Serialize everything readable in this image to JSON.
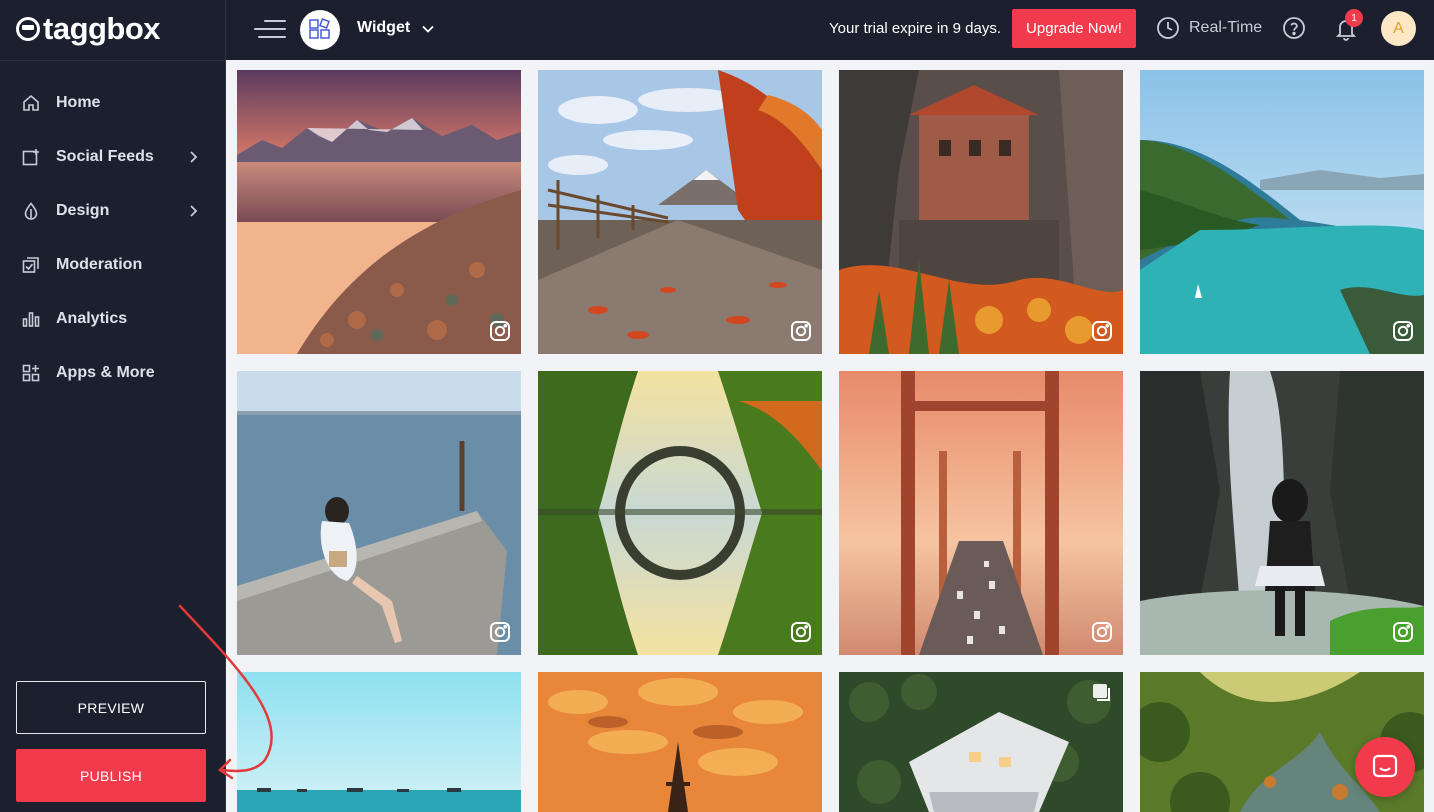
{
  "brand": {
    "logo_text": "taggbox",
    "accent": "#f13a4b",
    "sidebar_bg": "#1b1f2e"
  },
  "sidebar": {
    "items": [
      {
        "label": "Home",
        "icon": "home-icon",
        "has_submenu": false
      },
      {
        "label": "Social Feeds",
        "icon": "add-feed-icon",
        "has_submenu": true
      },
      {
        "label": "Design",
        "icon": "droplet-icon",
        "has_submenu": true
      },
      {
        "label": "Moderation",
        "icon": "moderation-icon",
        "has_submenu": false
      },
      {
        "label": "Analytics",
        "icon": "bar-chart-icon",
        "has_submenu": false
      },
      {
        "label": "Apps & More",
        "icon": "apps-grid-icon",
        "has_submenu": false
      }
    ],
    "preview_label": "PREVIEW",
    "publish_label": "PUBLISH"
  },
  "topbar": {
    "widget_label": "Widget",
    "trial_text": "Your trial expire in 9 days.",
    "upgrade_label": "Upgrade Now!",
    "realtime_label": "Real-Time",
    "notification_count": "1",
    "user_initial": "A"
  },
  "feed": {
    "tiles": [
      {
        "scene": "mountain-lake-sunset",
        "source": "instagram-icon"
      },
      {
        "scene": "autumn-path-mount-fuji",
        "source": "instagram-icon"
      },
      {
        "scene": "meteora-monastery-cliff",
        "source": "instagram-icon"
      },
      {
        "scene": "turquoise-lake-valley",
        "source": "instagram-icon"
      },
      {
        "scene": "woman-sitting-on-pier",
        "source": "instagram-icon"
      },
      {
        "scene": "stone-arch-bridge-reflection",
        "source": "instagram-icon"
      },
      {
        "scene": "golden-gate-bridge-traffic",
        "source": "instagram-icon"
      },
      {
        "scene": "woman-at-waterfall",
        "source": "instagram-icon"
      },
      {
        "scene": "turquoise-sea-horizon",
        "source": ""
      },
      {
        "scene": "eiffel-tower-golden-clouds",
        "source": ""
      },
      {
        "scene": "modern-house-in-forest",
        "source": "gallery-icon"
      },
      {
        "scene": "forest-stream",
        "source": ""
      }
    ]
  }
}
